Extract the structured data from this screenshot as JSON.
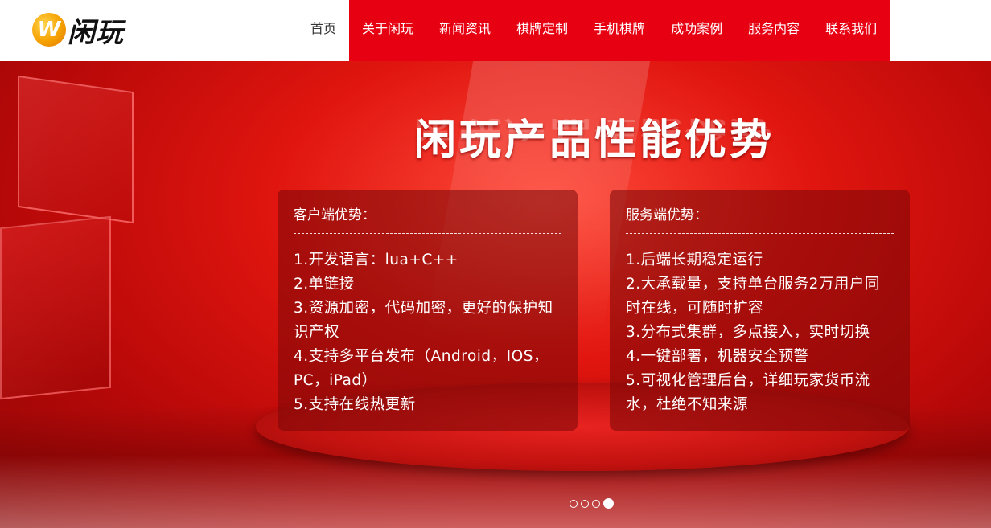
{
  "header": {
    "logo": {
      "mark": "W",
      "text": "闲玩"
    },
    "nav": [
      {
        "label": "首页"
      },
      {
        "label": "关于闲玩"
      },
      {
        "label": "新闻资讯"
      },
      {
        "label": "棋牌定制"
      },
      {
        "label": "手机棋牌"
      },
      {
        "label": "成功案例"
      },
      {
        "label": "服务内容"
      },
      {
        "label": "联系我们"
      }
    ]
  },
  "banner": {
    "title": "闲玩产品性能优势",
    "client": {
      "title": "客户端优势：",
      "items": [
        "1.开发语言：lua+C++",
        "2.单链接",
        "3.资源加密，代码加密，更好的保护知识产权",
        "4.支持多平台发布（Android，IOS，PC，iPad）",
        "5.支持在线热更新"
      ]
    },
    "server": {
      "title": "服务端优势：",
      "items": [
        "1.后端长期稳定运行",
        "2.大承载量，支持单台服务2万用户同时在线，可随时扩容",
        "3.分布式集群，多点接入，实时切换",
        "4.一键部署，机器安全预警",
        "5.可视化管理后台，详细玩家货币流水，杜绝不知来源"
      ]
    },
    "slides": {
      "count": 4,
      "active": 4
    }
  },
  "colors": {
    "nav_red": "#e60012",
    "banner_red": "#d0100c"
  }
}
